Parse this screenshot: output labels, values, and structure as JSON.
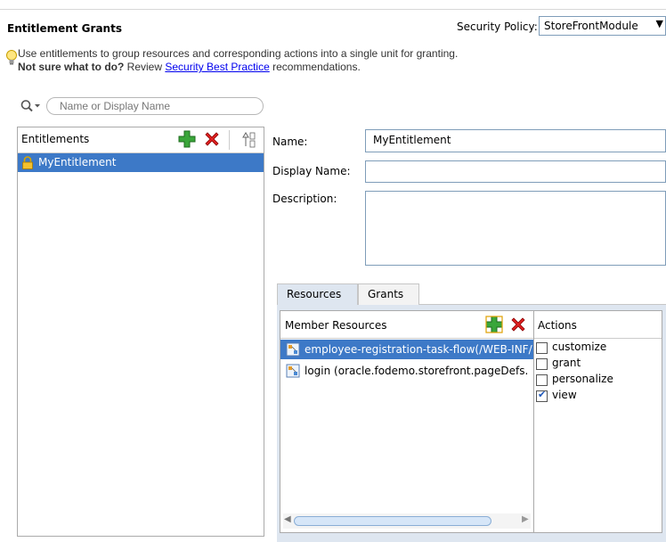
{
  "header": {
    "title": "Entitlement Grants",
    "policy_label": "Security Policy:",
    "policy_value": "StoreFrontModule"
  },
  "hint": {
    "line1": "Use entitlements to group resources and corresponding actions into a single unit for granting.",
    "bold": "Not sure what to do?",
    "review": "Review",
    "link": "Security Best Practice",
    "tail": "recommendations."
  },
  "search": {
    "placeholder": "Name or Display Name"
  },
  "entitlements": {
    "header": "Entitlements",
    "items": [
      {
        "label": "MyEntitlement",
        "selected": true
      }
    ]
  },
  "form": {
    "name_label": "Name:",
    "name_value": "MyEntitlement",
    "display_label": "Display Name:",
    "display_value": "",
    "description_label": "Description:",
    "description_value": ""
  },
  "tabs": [
    {
      "label": "Resources",
      "active": true
    },
    {
      "label": "Grants",
      "active": false
    }
  ],
  "resources": {
    "header": "Member Resources",
    "items": [
      {
        "label": "employee-registration-task-flow(/WEB-INF/",
        "selected": true
      },
      {
        "label": "login (oracle.fodemo.storefront.pageDefs.",
        "selected": false
      }
    ]
  },
  "actions": {
    "header": "Actions",
    "items": [
      {
        "label": "customize",
        "checked": false
      },
      {
        "label": "grant",
        "checked": false
      },
      {
        "label": "personalize",
        "checked": false
      },
      {
        "label": "view",
        "checked": true
      }
    ]
  },
  "colors": {
    "selection": "#3d79c7",
    "tab_panel": "#dee6f0",
    "link": "#0000ee",
    "add_icon": "#3aa63a",
    "delete_icon": "#e02020"
  }
}
